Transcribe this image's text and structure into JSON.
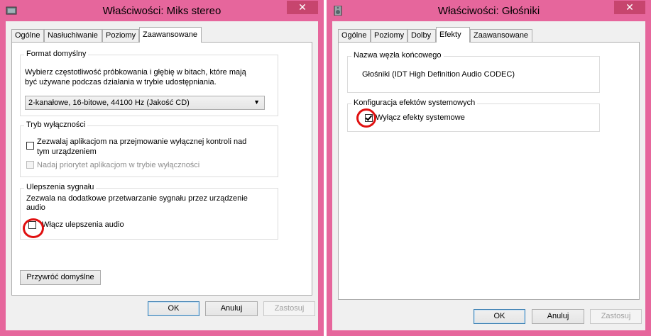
{
  "left": {
    "title": "Właściwości: Miks stereo",
    "close": "✕",
    "tabs": [
      "Ogólne",
      "Nasłuchiwanie",
      "Poziomy",
      "Zaawansowane"
    ],
    "format": {
      "title": "Format domyślny",
      "description_line1": "Wybierz częstotliwość próbkowania i głębię w bitach, które mają",
      "description_line2": "być używane podczas działania w trybie udostępniania.",
      "selected": "2-kanałowe, 16-bitowe, 44100 Hz (Jakość CD)"
    },
    "exclusive": {
      "title": "Tryb wyłączności",
      "option1_line1": "Zezwalaj aplikacjom na przejmowanie wyłącznej kontroli nad",
      "option1_line2": "tym urządzeniem",
      "option2": "Nadaj priorytet aplikacjom w trybie wyłączności"
    },
    "enhancements": {
      "title": "Ulepszenia sygnału",
      "description_line1": "Zezwala na dodatkowe przetwarzanie sygnału przez urządzenie",
      "description_line2": "audio",
      "checkbox_label": "Włącz ulepszenia audio"
    },
    "restore_button": "Przywróć domyślne",
    "ok": "OK",
    "cancel": "Anuluj",
    "apply": "Zastosuj"
  },
  "right": {
    "title": "Właściwości: Głośniki",
    "close": "✕",
    "tabs": [
      "Ogólne",
      "Poziomy",
      "Dolby",
      "Efekty",
      "Zaawansowane"
    ],
    "endpoint": {
      "title": "Nazwa węzła końcowego",
      "value": "Głośniki (IDT High Definition Audio CODEC)"
    },
    "effects": {
      "title": "Konfiguracja efektów systemowych",
      "checkbox_label": "Wyłącz efekty systemowe"
    },
    "ok": "OK",
    "cancel": "Anuluj",
    "apply": "Zastosuj"
  },
  "colors": {
    "window_frame": "#e6669c",
    "close_button": "#c7456e",
    "annotation_circle": "#e01010"
  }
}
